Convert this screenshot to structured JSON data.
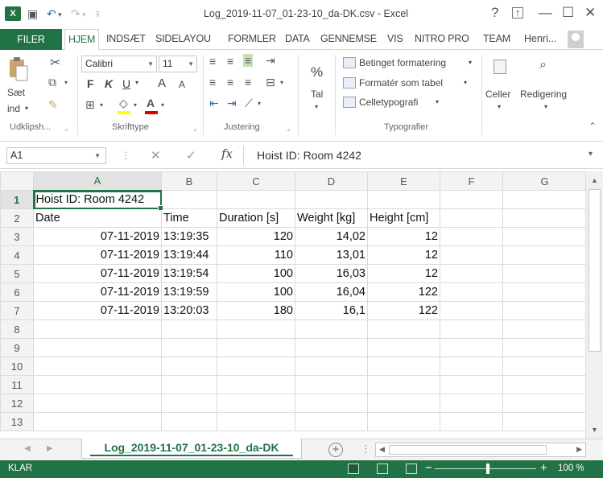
{
  "window": {
    "title": "Log_2019-11-07_01-23-10_da-DK.csv - Excel",
    "help": "?",
    "minimize": "—",
    "restore": "☐",
    "close": "✕"
  },
  "ribbon_tabs": [
    {
      "label": "FILER"
    },
    {
      "label": "HJEM"
    },
    {
      "label": "INDSÆT"
    },
    {
      "label": "SIDELAYOU"
    },
    {
      "label": "FORMLER"
    },
    {
      "label": "DATA"
    },
    {
      "label": "GENNEMSE"
    },
    {
      "label": "VIS"
    },
    {
      "label": "NITRO PRO"
    },
    {
      "label": "TEAM"
    }
  ],
  "user": {
    "name": "Henri..."
  },
  "ribbon": {
    "clipboard": {
      "paste_line1": "Sæt",
      "paste_line2": "ind",
      "label": "Udklipsh..."
    },
    "font": {
      "name": "Calibri",
      "size": "11",
      "bold": "F",
      "italic": "K",
      "underline": "U",
      "grow": "A",
      "shrink": "A",
      "label": "Skrifttype"
    },
    "alignment": {
      "label": "Justering"
    },
    "number": {
      "symbol": "%",
      "format": "Tal"
    },
    "styles": {
      "conditional": "Betinget formatering",
      "format_table": "Formatér som tabel",
      "cell_styles": "Celletypografi",
      "label": "Typografier"
    },
    "cells": {
      "label": "Celler"
    },
    "editing": {
      "label": "Redigering"
    }
  },
  "formula_bar": {
    "name_box": "A1",
    "cancel": "✕",
    "enter": "✓",
    "fx": "fx",
    "content": "Hoist ID: Room 4242"
  },
  "columns": [
    "A",
    "B",
    "C",
    "D",
    "E",
    "F",
    "G"
  ],
  "rows": [
    {
      "num": "1",
      "cells": [
        "Hoist ID: Room 4242",
        "",
        "",
        "",
        "",
        "",
        ""
      ]
    },
    {
      "num": "2",
      "cells": [
        "Date",
        "Time",
        "Duration [s]",
        "Weight [kg]",
        "Height [cm]",
        "",
        ""
      ]
    },
    {
      "num": "3",
      "cells": [
        "07-11-2019",
        "13:19:35",
        "120",
        "14,02",
        "12",
        "",
        ""
      ]
    },
    {
      "num": "4",
      "cells": [
        "07-11-2019",
        "13:19:44",
        "110",
        "13,01",
        "12",
        "",
        ""
      ]
    },
    {
      "num": "5",
      "cells": [
        "07-11-2019",
        "13:19:54",
        "100",
        "16,03",
        "12",
        "",
        ""
      ]
    },
    {
      "num": "6",
      "cells": [
        "07-11-2019",
        "13:19:59",
        "100",
        "16,04",
        "122",
        "",
        ""
      ]
    },
    {
      "num": "7",
      "cells": [
        "07-11-2019",
        "13:20:03",
        "180",
        "16,1",
        "122",
        "",
        ""
      ]
    },
    {
      "num": "8",
      "cells": [
        "",
        "",
        "",
        "",
        "",
        "",
        ""
      ]
    },
    {
      "num": "9",
      "cells": [
        "",
        "",
        "",
        "",
        "",
        "",
        ""
      ]
    },
    {
      "num": "10",
      "cells": [
        "",
        "",
        "",
        "",
        "",
        "",
        ""
      ]
    },
    {
      "num": "11",
      "cells": [
        "",
        "",
        "",
        "",
        "",
        "",
        ""
      ]
    },
    {
      "num": "12",
      "cells": [
        "",
        "",
        "",
        "",
        "",
        "",
        ""
      ]
    },
    {
      "num": "13",
      "cells": [
        "",
        "",
        "",
        "",
        "",
        "",
        ""
      ]
    }
  ],
  "sheet_tab": {
    "name": "Log_2019-11-07_01-23-10_da-DK",
    "add": "+"
  },
  "status": {
    "ready": "KLAR",
    "zoom": "100 %",
    "zoom_minus": "−",
    "zoom_plus": "+"
  },
  "colors": {
    "accent": "#217346"
  }
}
